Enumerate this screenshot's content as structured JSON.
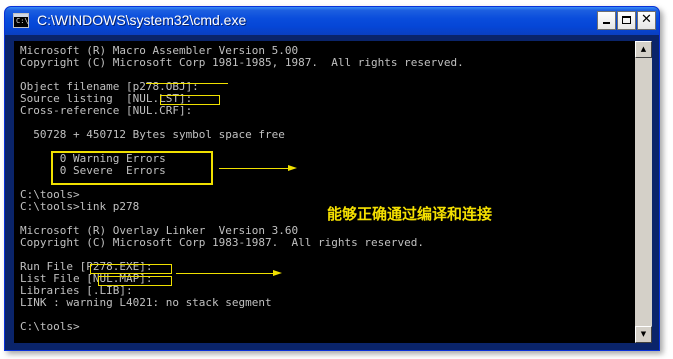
{
  "window": {
    "title": "C:\\WINDOWS\\system32\\cmd.exe",
    "app_icon_text": "C:\\",
    "buttons": {
      "minimize": "minimize",
      "maximize": "maximize",
      "close": "✕"
    }
  },
  "console": {
    "lines": [
      "Microsoft (R) Macro Assembler Version 5.00",
      "Copyright (C) Microsoft Corp 1981-1985, 1987.  All rights reserved.",
      "",
      "Object filename [p278.OBJ]:",
      "Source listing  [NUL.LST]:",
      "Cross-reference [NUL.CRF]:",
      "",
      "  50728 + 450712 Bytes symbol space free",
      "",
      "      0 Warning Errors",
      "      0 Severe  Errors",
      "",
      "C:\\tools>",
      "C:\\tools>link p278",
      "",
      "Microsoft (R) Overlay Linker  Version 3.60",
      "Copyright (C) Microsoft Corp 1983-1987.  All rights reserved.",
      "",
      "Run File [P278.EXE]:",
      "List File [NUL.MAP]:",
      "Libraries [.LIB]:",
      "LINK : warning L4021: no stack segment",
      "",
      "C:\\tools>"
    ]
  },
  "annotation": {
    "text": "能够正确通过编译和连接"
  },
  "colors": {
    "console_bg": "#000000",
    "console_text": "#c0c0c0",
    "highlight": "#f0e000",
    "titlebar": "#0a4ddc"
  }
}
